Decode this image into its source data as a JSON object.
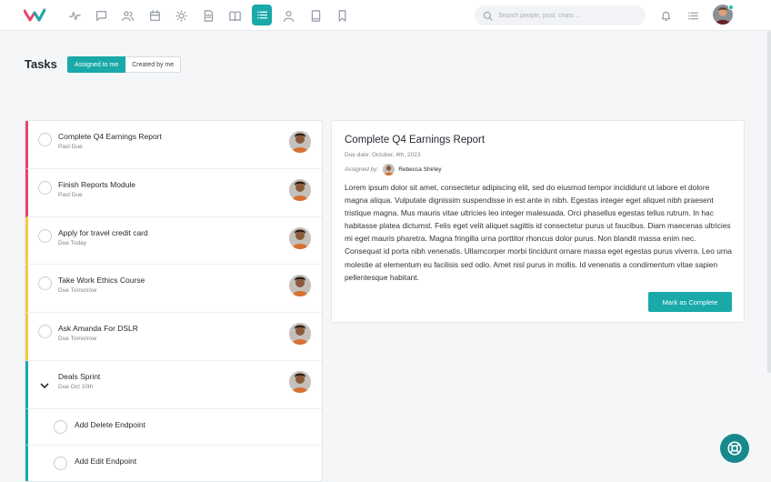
{
  "search": {
    "placeholder": "Search people, post, chats ..."
  },
  "nav_icons": [
    "activity-icon",
    "chat-icon",
    "users-icon",
    "calendar-icon",
    "sun-icon",
    "document-icon",
    "book-icon",
    "tasks-icon",
    "person-icon",
    "notebook-icon",
    "bookmark-icon"
  ],
  "active_nav": "tasks-icon",
  "header": {
    "title": "Tasks",
    "tabs": [
      {
        "label": "Assigned to me",
        "active": true
      },
      {
        "label": "Created by me",
        "active": false
      }
    ]
  },
  "colors": {
    "accent": "#19a9a9",
    "past_due": "#e8466b",
    "due_soon": "#f6c944",
    "sprint": "#19a9a9"
  },
  "tasks": [
    {
      "title": "Complete Q4 Earnings Report",
      "status": "Past Due",
      "color": "past_due"
    },
    {
      "title": "Finish Reports Module",
      "status": "Past Due",
      "color": "past_due"
    },
    {
      "title": "Apply for travel credit card",
      "status": "Due Today",
      "color": "due_soon"
    },
    {
      "title": "Take Work Ethics Course",
      "status": "Due Tomorrow",
      "color": "due_soon"
    },
    {
      "title": "Ask Amanda For DSLR",
      "status": "Due Tomorrow",
      "color": "due_soon"
    },
    {
      "title": "Deals Sprint",
      "status": "Due Oct 10th",
      "color": "sprint",
      "expanded": true
    }
  ],
  "subtasks": [
    {
      "title": "Add Delete Endpoint"
    },
    {
      "title": "Add Edit Endpoint"
    }
  ],
  "detail": {
    "title": "Complete Q4 Earnings Report",
    "due": "Due date: October, 4th, 2023",
    "assigned_label": "Assigned by:",
    "assigned_name": "Rebecca Shirley",
    "body": "Lorem ipsum dolor sit amet, consectetur adipiscing elit, sed do eiusmod tempor incididunt ut labore et dolore magna aliqua. Vulputate dignissim suspendisse in est ante in nibh. Egestas integer eget aliquet nibh praesent tristique magna. Mus mauris vitae ultricies leo integer malesuada. Orci phasellus egestas tellus rutrum. In hac habitasse platea dictumst. Felis eget velit aliquet sagittis id consectetur purus ut faucibus. Diam maecenas ultricies mi eget mauris pharetra. Magna fringilla urna porttitor rhoncus dolor purus. Non blandit massa enim nec. Consequat id porta nibh venenatis. Ullamcorper morbi tincidunt ornare massa eget egestas purus viverra. Leo urna molestie at elementum eu facilisis sed odio. Amet nisl purus in mollis. Id venenatis a condimentum vitae sapien pellentesque habitant.",
    "button": "Mark as Complete"
  }
}
